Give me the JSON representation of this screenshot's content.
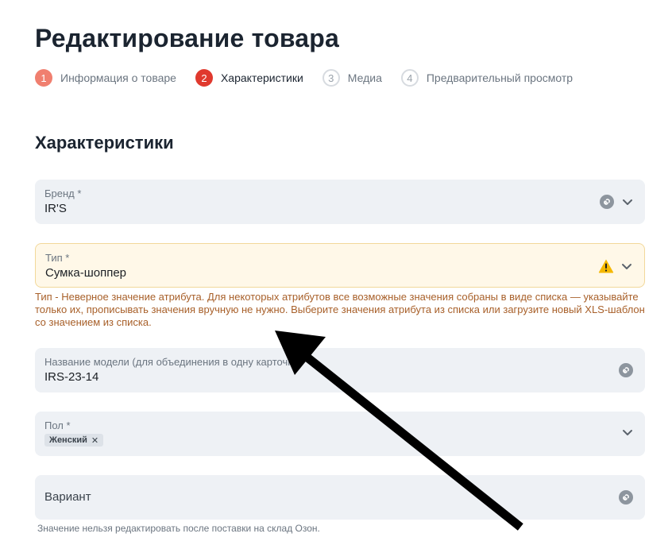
{
  "page": {
    "title": "Редактирование товара"
  },
  "stepper": {
    "steps": [
      {
        "num": "1",
        "label": "Информация о товаре",
        "state": "done"
      },
      {
        "num": "2",
        "label": "Характеристики",
        "state": "active"
      },
      {
        "num": "3",
        "label": "Медиа",
        "state": "todo"
      },
      {
        "num": "4",
        "label": "Предварительный просмотр",
        "state": "todo"
      }
    ]
  },
  "section": {
    "title": "Характеристики"
  },
  "fields": {
    "brand": {
      "label": "Бренд *",
      "value": "IR'S"
    },
    "type": {
      "label": "Тип *",
      "value": "Сумка-шоппер",
      "error": "Тип - Неверное значение атрибута. Для некоторых атрибутов все возможные значения собраны в виде списка — указывайте только их, прописывать значения вручную не нужно. Выберите значения атрибута из списка или загрузите новый XLS-шаблон со значением из списка."
    },
    "model": {
      "label": "Название модели (для объединения в одну карточку) *",
      "value": "IRS-23-14"
    },
    "gender": {
      "label": "Пол *",
      "chip": "Женский",
      "chip_remove": "✕"
    },
    "variant": {
      "placeholder": "Вариант",
      "hint": "Значение нельзя редактировать после поставки на склад Озон."
    }
  },
  "colors": {
    "step_done": "#f07f6f",
    "step_active": "#e0392e",
    "warning": "#f5b800",
    "error_text": "#a8602a",
    "field_bg": "#eef1f5"
  },
  "icons": {
    "link": "link-icon",
    "chevron": "chevron-down-icon",
    "warning": "warning-icon",
    "remove": "close-icon",
    "annotation": "arrow-annotation"
  }
}
